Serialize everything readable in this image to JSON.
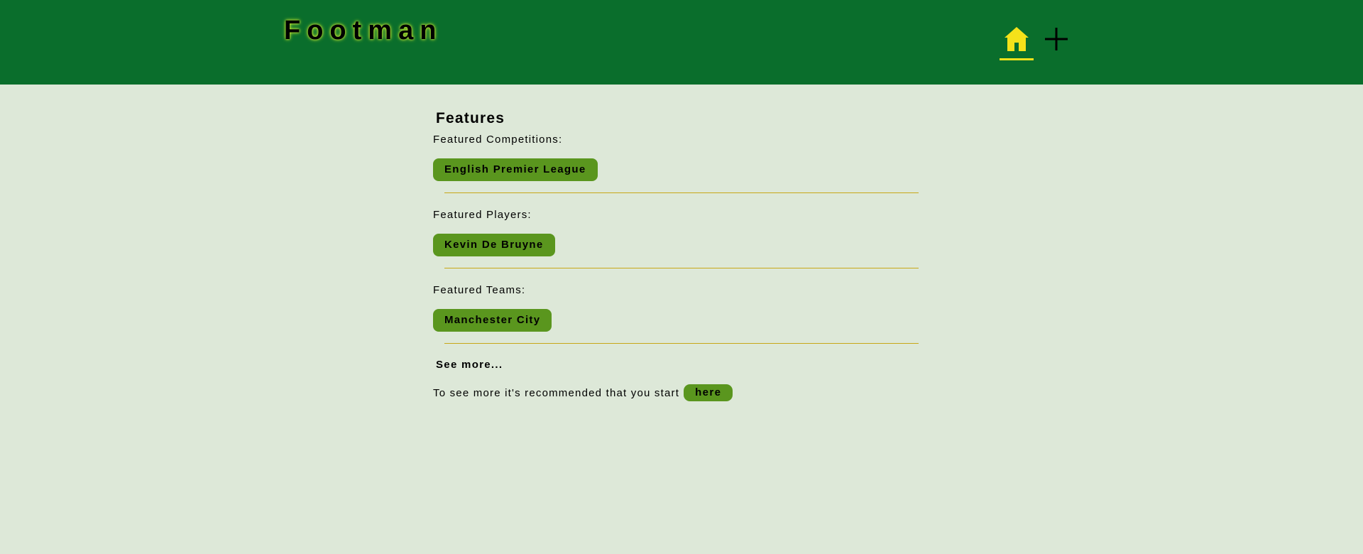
{
  "header": {
    "logo": "Footman",
    "nav": {
      "home_icon": "home-icon",
      "add_icon": "plus-icon"
    }
  },
  "colors": {
    "header_bg": "#0a6e2c",
    "page_bg": "#dde8d8",
    "accent_yellow": "#f5e21a",
    "pill_green": "#5a961e",
    "divider": "#c8a718"
  },
  "main": {
    "title": "Features",
    "sections": [
      {
        "label": "Featured Competitions:",
        "item": "English Premier League"
      },
      {
        "label": "Featured Players:",
        "item": "Kevin De Bruyne"
      },
      {
        "label": "Featured Teams:",
        "item": "Manchester City"
      }
    ],
    "see_more": "See more...",
    "cta_text": "To see more it's recommended that you start",
    "cta_button": "here"
  }
}
